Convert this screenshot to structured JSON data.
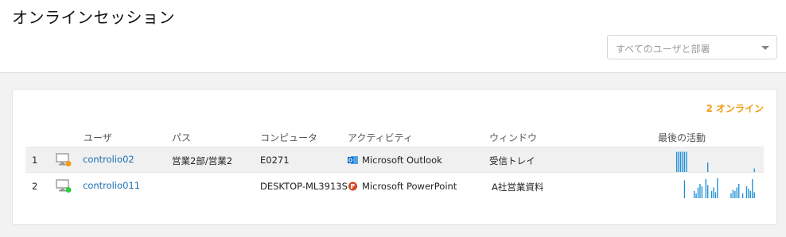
{
  "header": {
    "title": "オンラインセッション",
    "filter_placeholder": "すべてのユーザと部署"
  },
  "summary": {
    "online_count_text": "2 オンライン",
    "accent_color": "#f39c12"
  },
  "table": {
    "columns": {
      "user": "ユーザ",
      "path": "パス",
      "computer": "コンピュータ",
      "activity": "アクティビティ",
      "window": "ウィンドウ",
      "last_activity": "最後の活動"
    },
    "rows": [
      {
        "num": "1",
        "status": "away",
        "status_color": "#f39c12",
        "user": "controlio02",
        "path": "営業2部/営業2",
        "computer": "E0271",
        "app_icon": "outlook-icon",
        "activity": "Microsoft Outlook",
        "window": "受信トレイ",
        "activity_levels": [
          0.85,
          0.85,
          0.85,
          0.85,
          0.85,
          0.85,
          0,
          0,
          0,
          0,
          0,
          0,
          0,
          0,
          0,
          0,
          0.4,
          0,
          0,
          0,
          0,
          0,
          0,
          0,
          0,
          0,
          0,
          0,
          0,
          0,
          0,
          0,
          0,
          0,
          0,
          0,
          0,
          0,
          0,
          0,
          0.15
        ]
      },
      {
        "num": "2",
        "status": "online",
        "status_color": "#2ecc40",
        "user": "controlio011",
        "path": "",
        "computer": "DESKTOP-ML3913S",
        "app_icon": "powerpoint-icon",
        "activity": "Microsoft PowerPoint",
        "window": "A社営業資料",
        "activity_levels": [
          0,
          0,
          0,
          0,
          0.75,
          0,
          0,
          0,
          0,
          0.3,
          0.2,
          0.45,
          0.6,
          0.5,
          0,
          0.8,
          0.55,
          0,
          0.3,
          0.45,
          0.25,
          0.85,
          0,
          0,
          0,
          0,
          0,
          0,
          0.2,
          0.35,
          0.3,
          0.45,
          0.6,
          0,
          0.2,
          0,
          0.5,
          0.4,
          0.3,
          0.8,
          0.25
        ]
      }
    ]
  },
  "colors": {
    "link": "#1a6fb5",
    "spark": "#1a8fd6"
  }
}
